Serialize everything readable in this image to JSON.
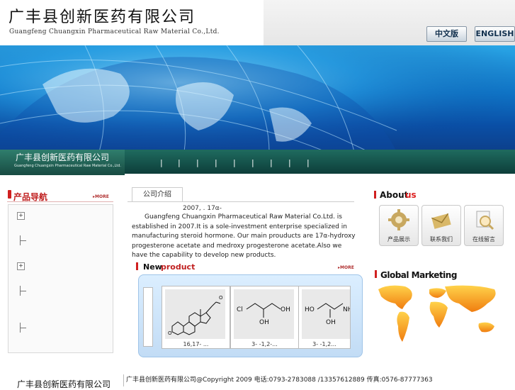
{
  "header": {
    "title": "广丰县创新医药有限公司",
    "subtitle": "Guangfeng Chuangxin Pharmaceutical Raw Material Co.,Ltd.",
    "lang_cn": "中文版",
    "lang_en": "ENGLISH"
  },
  "nav": {
    "logo_cn": "广丰县创新医药有限公司",
    "logo_en": "Guangfeng Chuangxin Pharmaceutical Raw Material Co.,Ltd.",
    "separators": [
      "|",
      "|",
      "|",
      "|",
      "|",
      "|",
      "|",
      "|",
      "|"
    ]
  },
  "left": {
    "title": "产品导航",
    "more": "MORE",
    "tree_plus": "+"
  },
  "middle": {
    "tab": "公司介绍",
    "about_line1": "2007,              .             17α-",
    "about_text": "Guangfeng Chuangxin Pharmaceutical Raw Material Co.Ltd. is established in 2007.It is a sole-investment enterprise specialized in manufacturing steroid hormone. Our main prouducts are 17α-hydroxy progesterone acetate and medroxy progesterone acetate.Also we have the capability to develop new products.",
    "new_title_1": "New",
    "new_title_2": "product",
    "new_more": "MORE",
    "products": [
      {
        "label": "16,17-  ..."
      },
      {
        "label": "3-  -1,2-..."
      },
      {
        "label": "3-  -1,2..."
      }
    ],
    "structure_labels": {
      "cl": "Cl",
      "oh": "OH",
      "ho": "HO",
      "nh": "NH"
    }
  },
  "right": {
    "about_1": "About",
    "about_2": "us",
    "icons": [
      {
        "label": "产品展示",
        "icon": "gear-icon"
      },
      {
        "label": "联系我们",
        "icon": "mail-icon"
      },
      {
        "label": "在线留言",
        "icon": "magnifier-icon"
      }
    ],
    "global": "Global Marketing"
  },
  "footer": {
    "logo": "广丰县创新医药有限公司",
    "text": "广丰县创新医药有限公司@Copyright 2009 电话:0793-2783088 /13357612889 传真:0576-87777363"
  },
  "colors": {
    "accent_red": "#c02020",
    "nav_green": "#0d3e3a",
    "banner_blue": "#0f76c8"
  }
}
